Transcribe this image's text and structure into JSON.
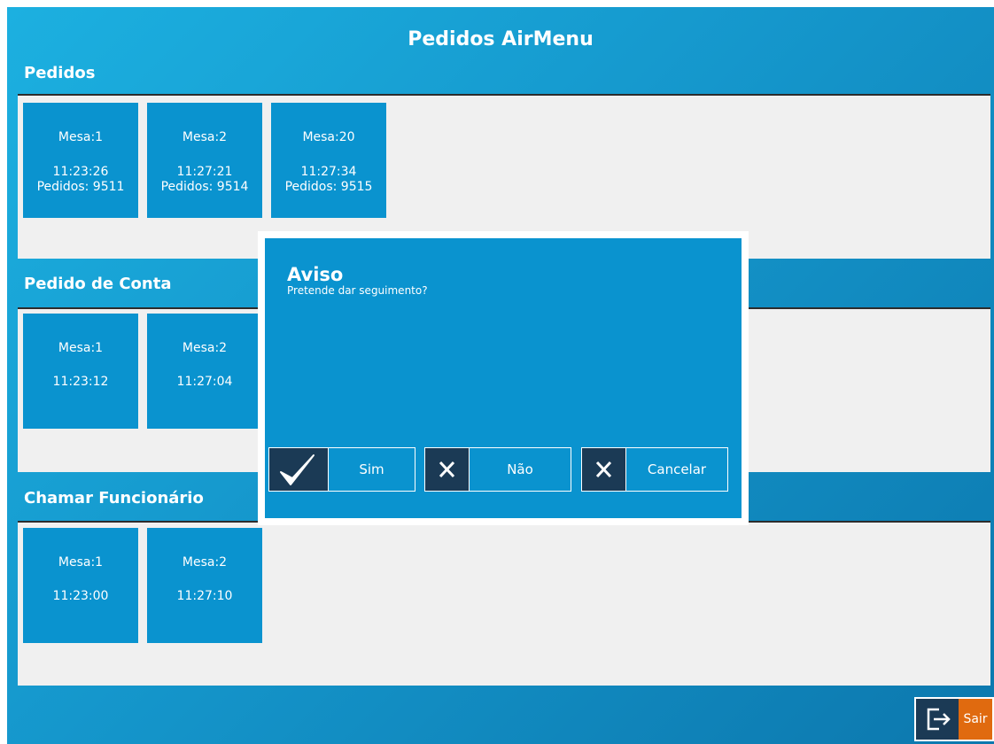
{
  "header": {
    "title": "Pedidos AirMenu"
  },
  "sections": {
    "pedidos": {
      "label": "Pedidos",
      "tiles": [
        {
          "mesa": "Mesa:1",
          "time": "11:23:26",
          "orders": "Pedidos: 9511"
        },
        {
          "mesa": "Mesa:2",
          "time": "11:27:21",
          "orders": "Pedidos: 9514"
        },
        {
          "mesa": "Mesa:20",
          "time": "11:27:34",
          "orders": "Pedidos: 9515"
        }
      ]
    },
    "conta": {
      "label": "Pedido de Conta",
      "tiles": [
        {
          "mesa": "Mesa:1",
          "time": "11:23:12"
        },
        {
          "mesa": "Mesa:2",
          "time": "11:27:04"
        }
      ]
    },
    "funcionario": {
      "label": "Chamar Funcionário",
      "tiles": [
        {
          "mesa": "Mesa:1",
          "time": "11:23:00"
        },
        {
          "mesa": "Mesa:2",
          "time": "11:27:10"
        }
      ]
    }
  },
  "dialog": {
    "title": "Aviso",
    "message": "Pretende dar seguimento?",
    "buttons": {
      "yes": {
        "label": "Sim",
        "icon": "check-icon"
      },
      "no": {
        "label": "Não",
        "icon": "x-icon"
      },
      "cancel": {
        "label": "Cancelar",
        "icon": "x-icon"
      }
    }
  },
  "footer": {
    "exit_label": "Sair",
    "exit_icon": "logout-icon"
  },
  "colors": {
    "tile": "#0a93cf",
    "icon_bg": "#1b3a55",
    "exit_accent": "#e06a0f",
    "panel_bg": "#f0f0f0"
  }
}
